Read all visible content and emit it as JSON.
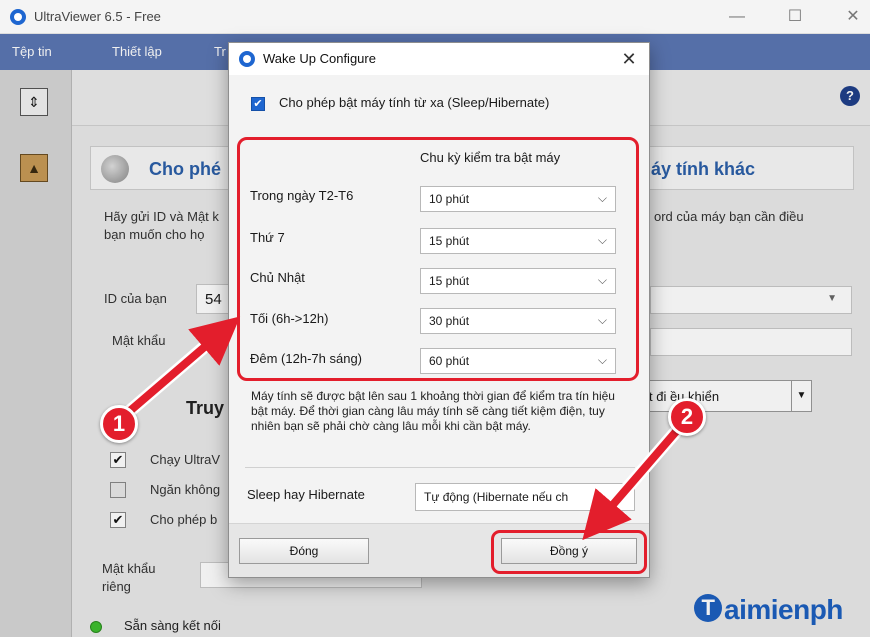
{
  "main_window": {
    "title": "UltraViewer 6.5 - Free",
    "menu": [
      "Tệp tin",
      "Thiết lập",
      "Tr"
    ],
    "header_left": "Cho phé",
    "header_right": "áy tính khác",
    "body_left_line1": "Hãy gửi ID và Mật k",
    "body_left_line2": "bạn muốn cho họ",
    "body_right": "ord của máy bạn cần điều",
    "id_label": "ID của bạn",
    "id_value": "54",
    "password_label": "Mật khẩu",
    "truy_label": "Truy",
    "options": [
      {
        "label": "Chạy UltraV",
        "checked": true
      },
      {
        "label": "Ngăn không",
        "checked": false
      },
      {
        "label": "Cho phép b",
        "checked": true
      }
    ],
    "control_select_value": "t đi  ều khiển",
    "private_password_label_1": "Mật khẩu",
    "private_password_label_2": "riêng",
    "status": "Sẵn sàng kết nối",
    "watermark": "aimienph",
    "watermark_initial": "T"
  },
  "dialog": {
    "title": "Wake Up Configure",
    "close_glyph": "✕",
    "allow_remote_wake": {
      "label": "Cho phép bật máy tính từ xa (Sleep/Hibernate)",
      "checked": true
    },
    "schedule_header": "Chu kỳ kiểm tra bật máy",
    "schedule": [
      {
        "label": "Trong ngày T2-T6",
        "value": "10 phút"
      },
      {
        "label": "Thứ 7",
        "value": "15 phút"
      },
      {
        "label": "Chủ Nhật",
        "value": "15 phút"
      },
      {
        "label": "Tối (6h->12h)",
        "value": "30 phút"
      },
      {
        "label": "Đêm (12h-7h sáng)",
        "value": "60 phút"
      }
    ],
    "info_text": "Máy tính sẽ được bật lên sau 1 khoảng thời gian để kiểm tra tín hiệu bật máy. Để thời gian càng lâu máy tính sẽ càng tiết kiệm điện, tuy nhiên bạn sẽ phải chờ càng lâu mỗi khi cần bật máy.",
    "sleep_label": "Sleep hay Hibernate",
    "sleep_value": "Tự động (Hibernate nếu ch",
    "close_button": "Đóng",
    "ok_button": "Đồng ý"
  },
  "annotations": {
    "badge_1": "1",
    "badge_2": "2",
    "accent_color": "#e31e2c"
  }
}
